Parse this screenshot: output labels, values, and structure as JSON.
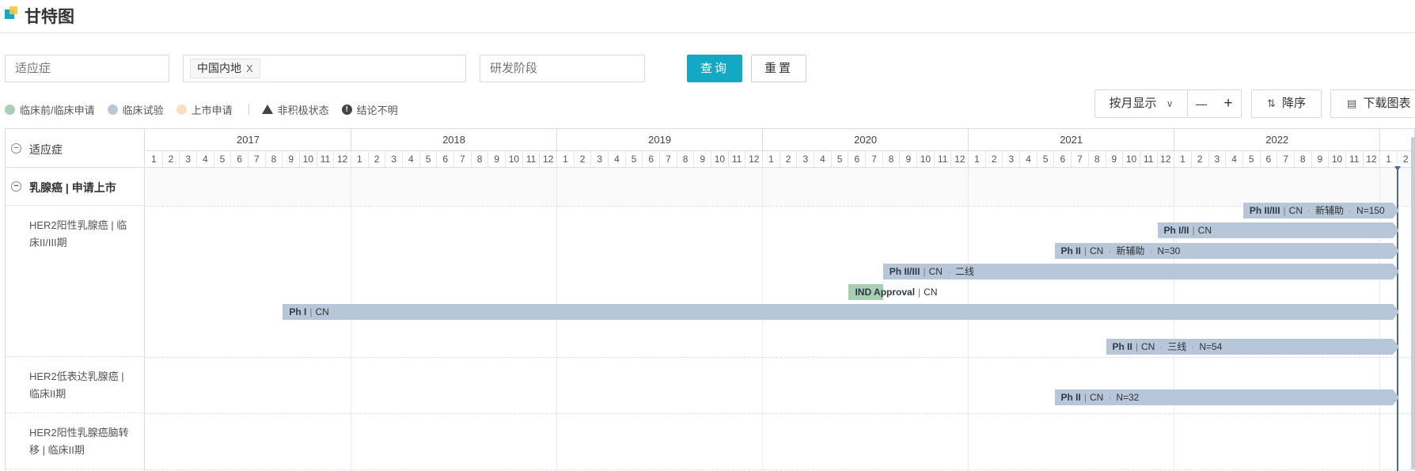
{
  "header": {
    "title": "甘特图"
  },
  "filters": {
    "indication_placeholder": "适应症",
    "region_tag": "中国内地",
    "region_tag_close": "X",
    "stage_placeholder": "研发阶段",
    "query_label": "查询",
    "reset_label": "重置"
  },
  "legend": {
    "items": [
      {
        "label": "临床前/临床申请",
        "color": "#a9cfb3"
      },
      {
        "label": "临床试验",
        "color": "#b7c6d9"
      },
      {
        "label": "上市申请",
        "color": "#f9dec3"
      }
    ],
    "inactive_label": "非积极状态",
    "unclear_label": "结论不明"
  },
  "toolbar": {
    "view_mode": "按月显示",
    "zoom_out": "—",
    "zoom_in": "+",
    "sort_label": "降序",
    "download_label": "下载图表"
  },
  "gantt": {
    "column_header": "适应症",
    "years": [
      "2017",
      "2018",
      "2019",
      "2020",
      "2021",
      "2022"
    ],
    "months": [
      "1",
      "2",
      "3",
      "4",
      "5",
      "6",
      "7",
      "8",
      "9",
      "10",
      "11",
      "12"
    ],
    "trailing_months": [
      "1",
      "2"
    ],
    "group": {
      "label": "乳腺癌 | 申请上市",
      "toggle": "−"
    },
    "header_toggle": "−",
    "rows": [
      {
        "label": "HER2阳性乳腺癌 | 临床II/III期",
        "bars": [
          {
            "phase": "Ph II/III",
            "region": "CN",
            "tags": [
              "新辅助",
              "N=150"
            ],
            "start": "2022-05",
            "status": "clinical"
          },
          {
            "phase": "Ph I/II",
            "region": "CN",
            "tags": [],
            "start": "2021-12",
            "status": "clinical"
          },
          {
            "phase": "Ph II",
            "region": "CN",
            "tags": [
              "新辅助",
              "N=30"
            ],
            "start": "2021-06",
            "status": "clinical"
          },
          {
            "phase": "Ph II/III",
            "region": "CN",
            "tags": [
              "二线"
            ],
            "start": "2020-08",
            "status": "clinical"
          },
          {
            "phase": "IND Approval",
            "region": "CN",
            "tags": [],
            "start": "2020-06",
            "end": "2020-08",
            "status": "preclinical"
          },
          {
            "phase": "Ph I",
            "region": "CN",
            "tags": [],
            "start": "2017-09",
            "status": "clinical"
          }
        ]
      },
      {
        "label": "HER2低表达乳腺癌 | 临床II期",
        "bars": [
          {
            "phase": "Ph II",
            "region": "CN",
            "tags": [
              "三线",
              "N=54"
            ],
            "start": "2021-09",
            "status": "clinical"
          }
        ]
      },
      {
        "label": "HER2阳性乳腺癌脑转移 | 临床II期",
        "bars": [
          {
            "phase": "Ph II",
            "region": "CN",
            "tags": [
              "N=32"
            ],
            "start": "2021-06",
            "status": "clinical"
          }
        ]
      }
    ],
    "today": "2023-02",
    "colors": {
      "clinical": "#b7c6d9",
      "preclinical": "#a9cfb3",
      "filing": "#f9dec3",
      "today": "#4b6a8f"
    }
  }
}
